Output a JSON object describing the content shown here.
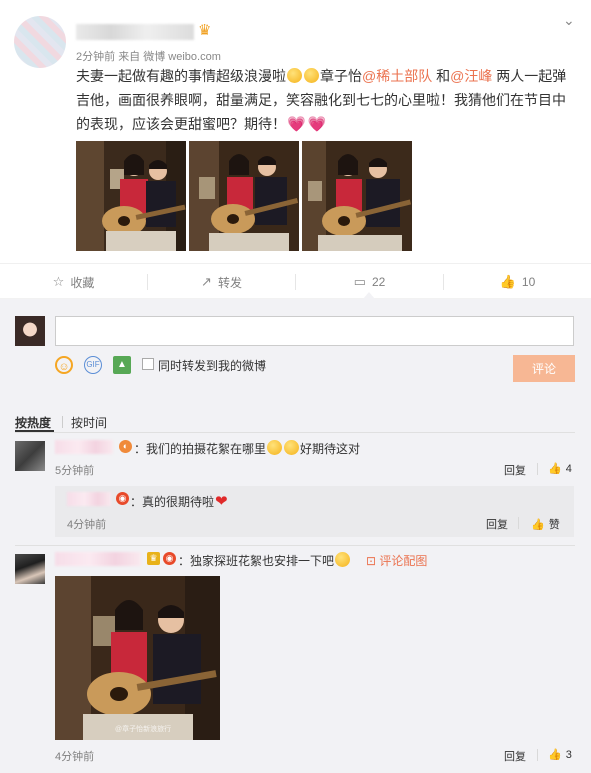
{
  "post": {
    "meta_time": "2分钟前",
    "meta_from": "来自",
    "meta_source": "微博 weibo.com",
    "text_part1": "夫妻一起做有趣的事情超级浪漫啦",
    "text_part2": "章子怡",
    "mention1": "@稀土部队",
    "text_and": " 和",
    "mention2": "@汪峰",
    "text_part3": " 两人一起弹吉他，画面很养眼啊，甜量满足，笑容融化到七七的心里啦！我猜他们在节目中的表现，应该会更甜蜜吧？期待！",
    "images": [
      "photo-1",
      "photo-2",
      "photo-3"
    ]
  },
  "actions": {
    "collect_label": "收藏",
    "forward_label": "转发",
    "comment_count": "22",
    "like_count": "10"
  },
  "composer": {
    "input_value": "",
    "input_placeholder": "",
    "forward_to_weibo": "同时转发到我的微博",
    "submit_label": "评论",
    "gif_label": "GIF"
  },
  "sort": {
    "hot_label": "按热度",
    "time_label": "按时间"
  },
  "comments": [
    {
      "text_a": "：我们的拍摄花絮在哪里",
      "text_b": "好期待这对",
      "time": "5分钟前",
      "reply_label": "回复",
      "likes": "4",
      "replies": [
        {
          "text": "：真的很期待啦",
          "time": "4分钟前",
          "reply_label": "回复",
          "like_label": "赞"
        }
      ]
    },
    {
      "text": "：独家探班花絮也安排一下吧",
      "tag": "评论配图",
      "time": "4分钟前",
      "reply_label": "回复",
      "likes": "3",
      "image_watermark": "@章子怡新浪旅行"
    }
  ],
  "colors": {
    "accent": "#eb7350",
    "submit_bg": "#f7b794",
    "comment_bg": "#f2f2f5"
  }
}
